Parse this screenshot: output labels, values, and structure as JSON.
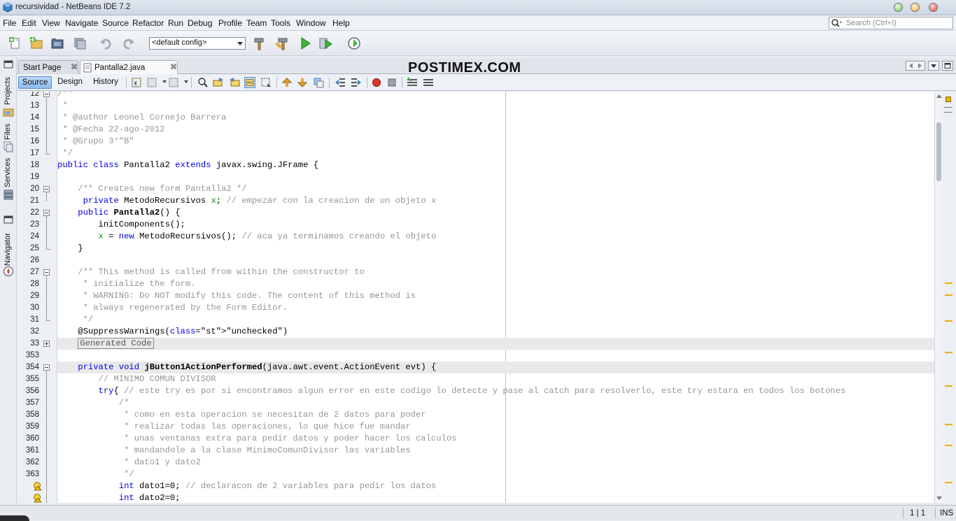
{
  "window": {
    "title": "recursividad - NetBeans IDE 7.2"
  },
  "menu": [
    "File",
    "Edit",
    "View",
    "Navigate",
    "Source",
    "Refactor",
    "Run",
    "Debug",
    "Profile",
    "Team",
    "Tools",
    "Window",
    "Help"
  ],
  "search": {
    "placeholder": "Search (Ctrl+I)"
  },
  "toolbar": {
    "config": "<default config>"
  },
  "side_tabs": [
    "Projects",
    "Files",
    "Services",
    "Navigator"
  ],
  "editor_tabs": [
    {
      "label": "Start Page",
      "active": false
    },
    {
      "label": "Pantalla2.java",
      "active": true
    }
  ],
  "brand": "POSTIMEX.COM",
  "view_buttons": [
    "Source",
    "Design",
    "History"
  ],
  "code_lines": [
    {
      "n": "12",
      "t": "/**"
    },
    {
      "n": "13",
      "t": " *"
    },
    {
      "n": "14",
      "t": " * @author Leonel Cornejo Barrera"
    },
    {
      "n": "15",
      "t": " * @Fecha 22-ago-2012"
    },
    {
      "n": "16",
      "t": " * @Grupo 3°\"B\""
    },
    {
      "n": "17",
      "t": " */"
    },
    {
      "n": "18",
      "t": "public class Pantalla2 extends javax.swing.JFrame {"
    },
    {
      "n": "19",
      "t": ""
    },
    {
      "n": "20",
      "t": "    /** Creates new form Pantalla2 */"
    },
    {
      "n": "21",
      "t": "     private MetodoRecursivos x; // empezar con la creacion de un objeto x"
    },
    {
      "n": "22",
      "t": "    public Pantalla2() {"
    },
    {
      "n": "23",
      "t": "        initComponents();"
    },
    {
      "n": "24",
      "t": "        x = new MetodoRecursivos(); // aca ya terminamos creando el objeto"
    },
    {
      "n": "25",
      "t": "    }"
    },
    {
      "n": "26",
      "t": ""
    },
    {
      "n": "27",
      "t": "    /** This method is called from within the constructor to"
    },
    {
      "n": "28",
      "t": "     * initialize the form."
    },
    {
      "n": "29",
      "t": "     * WARNING: Do NOT modify this code. The content of this method is"
    },
    {
      "n": "30",
      "t": "     * always regenerated by the Form Editor."
    },
    {
      "n": "31",
      "t": "     */"
    },
    {
      "n": "32",
      "t": "    @SuppressWarnings(\"unchecked\")"
    },
    {
      "n": "33",
      "t": "    Generated Code"
    },
    {
      "n": "353",
      "t": ""
    },
    {
      "n": "354",
      "t": "    private void jButton1ActionPerformed(java.awt.event.ActionEvent evt) {"
    },
    {
      "n": "355",
      "t": "        // MINIMO COMUN DIVISOR"
    },
    {
      "n": "356",
      "t": "        try{ // este try es por si encontramos algun error en este codigo lo detecte y pase al catch para resolverlo, este try estara en todos los botones"
    },
    {
      "n": "357",
      "t": "            /*"
    },
    {
      "n": "358",
      "t": "             * como en esta operacion se necesitan de 2 datos para poder"
    },
    {
      "n": "359",
      "t": "             * realizar todas las operaciones, lo que hice fue mandar"
    },
    {
      "n": "360",
      "t": "             * unas ventanas extra para pedir datos y poder hacer los calculos"
    },
    {
      "n": "361",
      "t": "             * mandandole a la clase MinimoComunDivisor las variables"
    },
    {
      "n": "362",
      "t": "             * dato1 y dato2"
    },
    {
      "n": "363",
      "t": "             */"
    },
    {
      "n": "",
      "t": "            int dato1=0; // declaracon de 2 variables para pedir los datos"
    },
    {
      "n": "",
      "t": "            int dato2=0;"
    }
  ],
  "status": {
    "position": "1 | 1",
    "mode": "INS"
  }
}
